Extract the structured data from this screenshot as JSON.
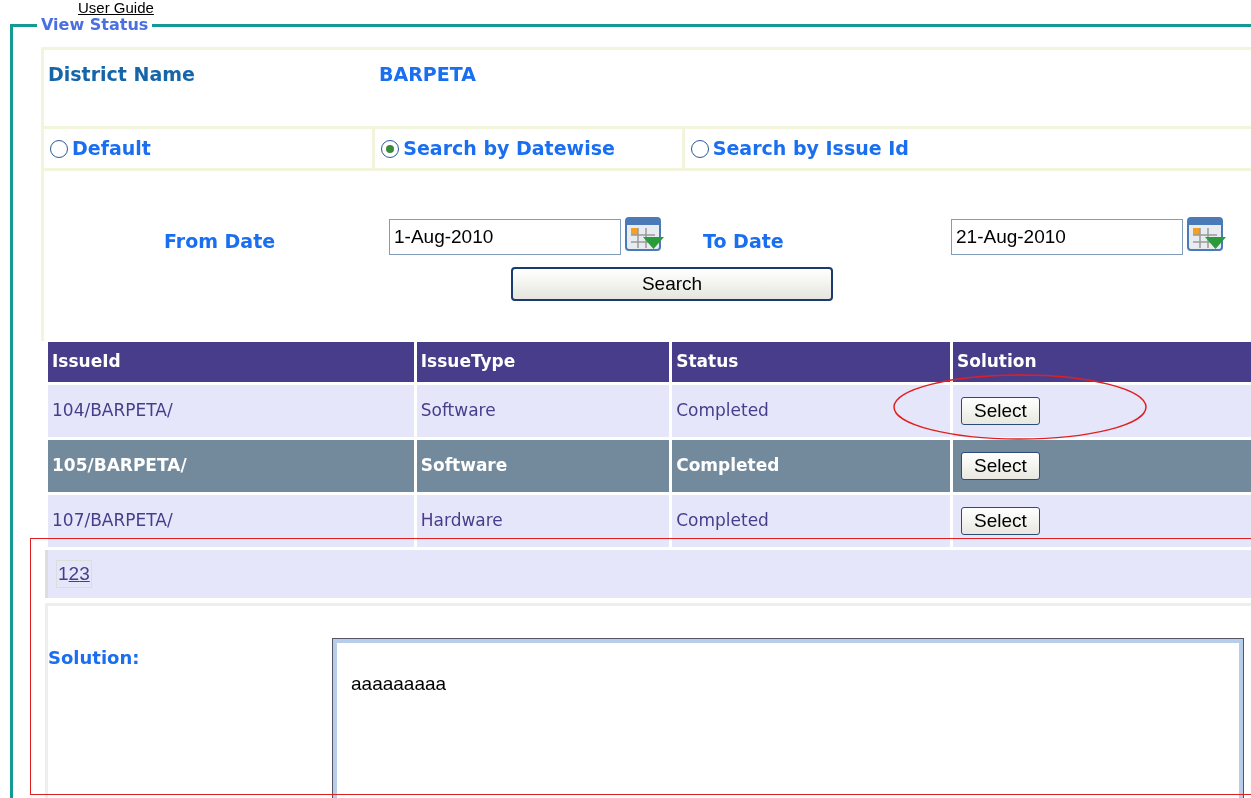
{
  "top_link": "User Guide",
  "panel": {
    "legend": "View Status"
  },
  "district": {
    "label": "District Name",
    "value": "BARPETA"
  },
  "search_modes": [
    {
      "label": "Default",
      "selected": false
    },
    {
      "label": "Search by Datewise",
      "selected": true
    },
    {
      "label": "Search by Issue Id",
      "selected": false
    }
  ],
  "from_date": {
    "label": "From Date",
    "value": "1-Aug-2010"
  },
  "to_date": {
    "label": "To Date",
    "value": "21-Aug-2010"
  },
  "search_button": "Search",
  "table": {
    "columns": [
      "IssueId",
      "IssueType",
      "Status",
      "Solution"
    ],
    "rows": [
      {
        "cells": [
          "104/BARPETA/",
          "Software",
          "Completed"
        ],
        "button": "Select",
        "selected": false
      },
      {
        "cells": [
          "105/BARPETA/",
          "Software",
          "Completed"
        ],
        "button": "Select",
        "selected": true
      },
      {
        "cells": [
          "107/BARPETA/",
          "Hardware",
          "Completed"
        ],
        "button": "Select",
        "selected": false
      }
    ]
  },
  "pager": [
    {
      "label": "1",
      "selected": true
    },
    {
      "label": "2",
      "selected": false
    },
    {
      "label": "3",
      "selected": false
    }
  ],
  "solution": {
    "label": "Solution:",
    "value": "aaaaaaaaa"
  }
}
